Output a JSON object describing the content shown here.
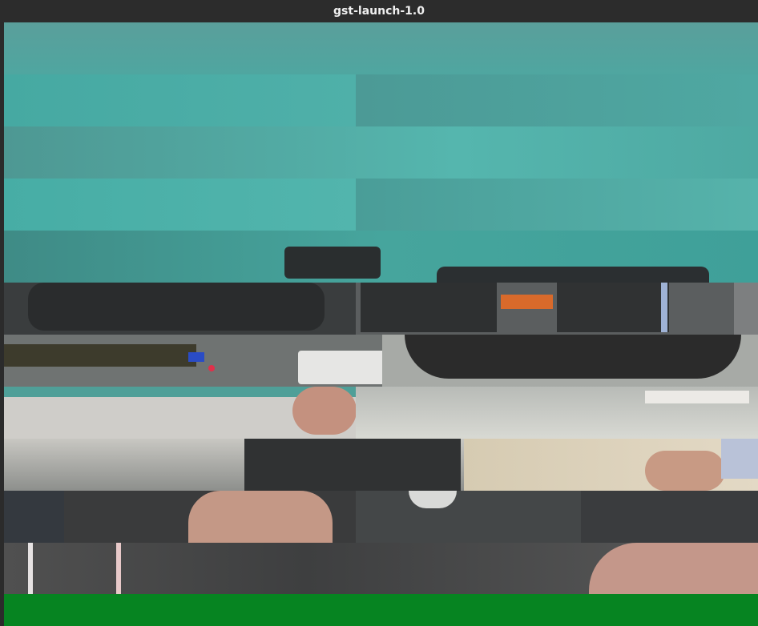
{
  "window": {
    "title": "gst-launch-1.0"
  },
  "colors": {
    "titlebar": "#2c2c2c",
    "title_text": "#f0f0f0",
    "teal_wall": "#4fa9a3",
    "green_strip": "#068421",
    "dark_object": "#2f3233",
    "skin": "#c9a08f"
  },
  "video": {
    "description_icon": "corrupted-video-frame"
  }
}
